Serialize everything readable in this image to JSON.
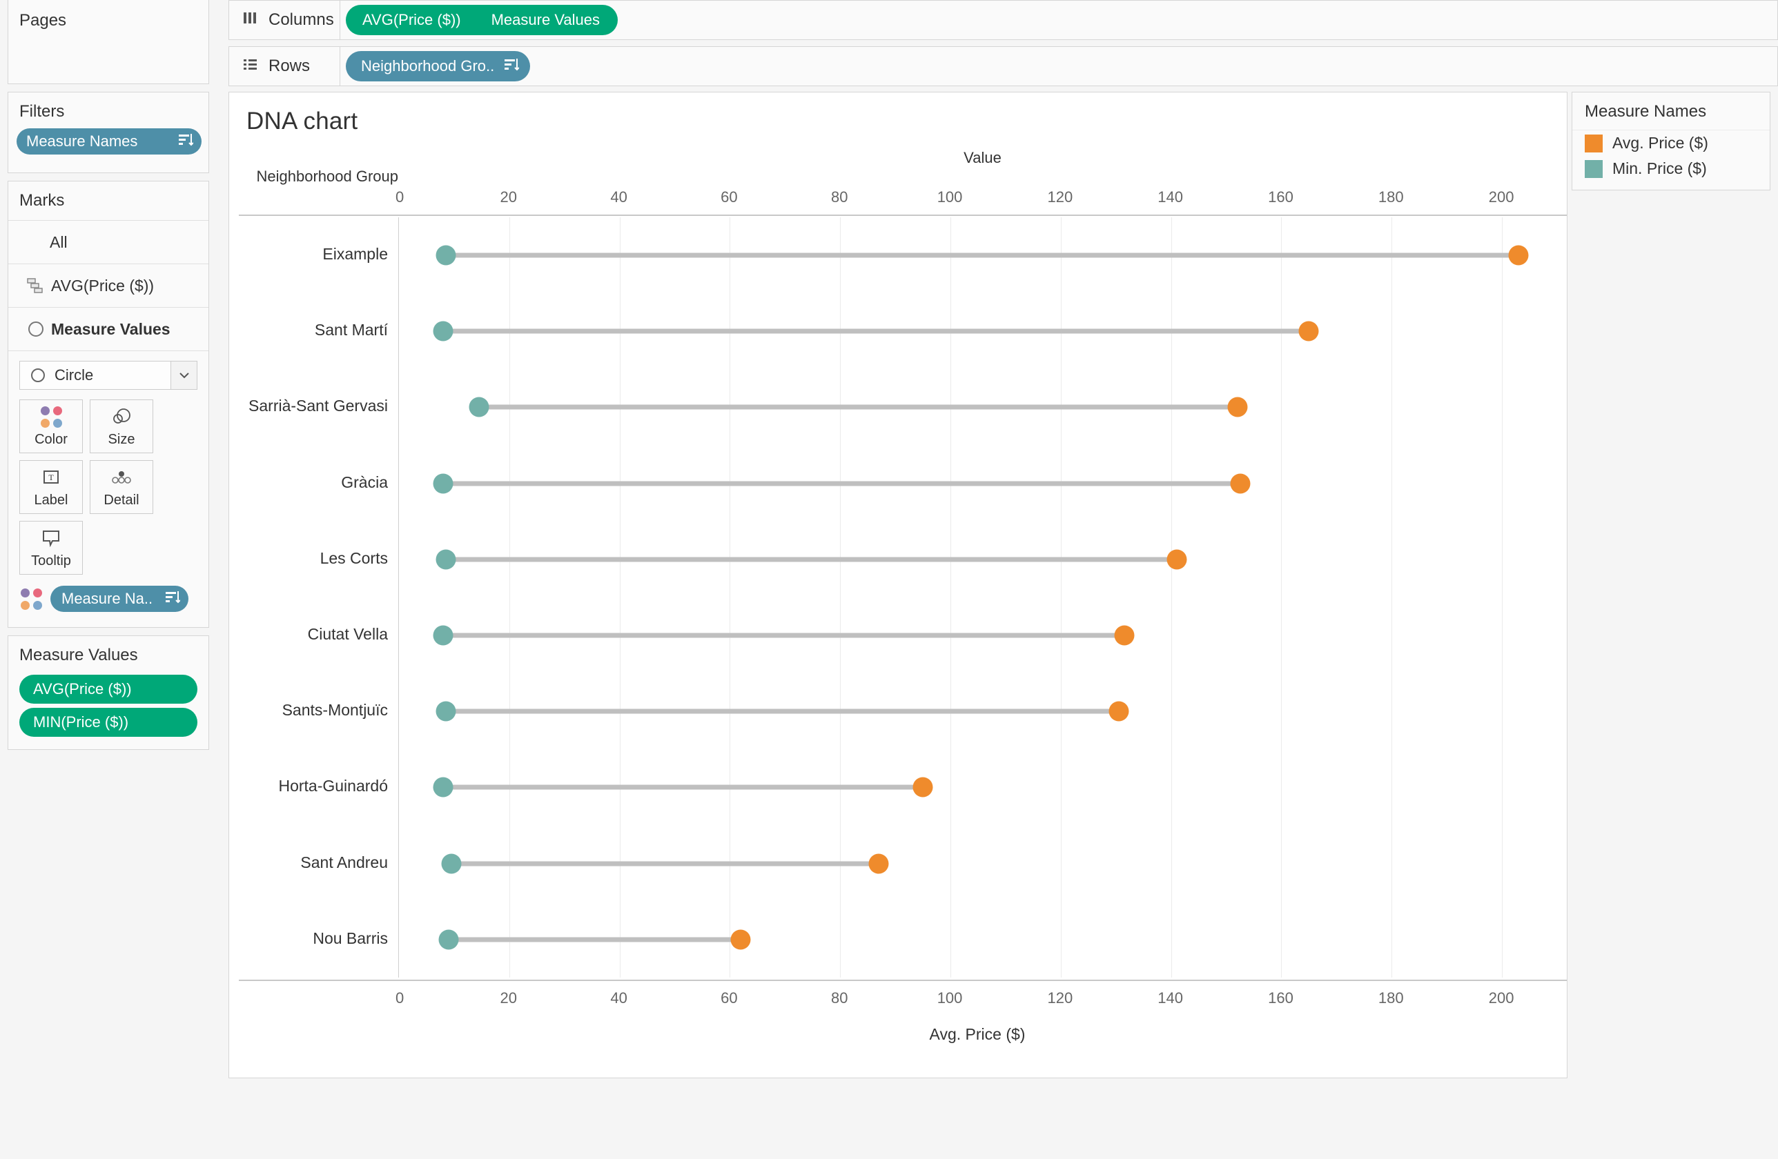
{
  "shelves": {
    "pages": {
      "title": "Pages"
    },
    "filters": {
      "title": "Filters",
      "pill": "Measure Names"
    },
    "columns": {
      "label": "Columns",
      "pills": [
        "AVG(Price ($))",
        "Measure Values"
      ]
    },
    "rows": {
      "label": "Rows",
      "pills": [
        "Neighborhood Gro.."
      ]
    }
  },
  "marks": {
    "title": "Marks",
    "all_label": "All",
    "card_rows": [
      {
        "label": "AVG(Price ($))",
        "icon": "gantt-icon",
        "active": false
      },
      {
        "label": "Measure Values",
        "icon": "circle-icon",
        "active": true
      }
    ],
    "mark_type": "Circle",
    "buttons": [
      {
        "label": "Color",
        "icon": "color-dots-icon"
      },
      {
        "label": "Size",
        "icon": "size-circles-icon"
      },
      {
        "label": "Label",
        "icon": "label-text-icon"
      },
      {
        "label": "Detail",
        "icon": "detail-dots-icon"
      },
      {
        "label": "Tooltip",
        "icon": "tooltip-bubble-icon"
      }
    ],
    "color_pill": "Measure Na..",
    "color_swatches": [
      "#8e7cb0",
      "#e8697d",
      "#f0a868",
      "#7ea7cc"
    ]
  },
  "measure_values": {
    "title": "Measure Values",
    "pills": [
      "AVG(Price ($))",
      "MIN(Price ($))"
    ]
  },
  "legend": {
    "title": "Measure Names",
    "items": [
      {
        "label": "Avg. Price ($)",
        "color": "#ef8b2c"
      },
      {
        "label": "Min. Price ($)",
        "color": "#72b0a8"
      }
    ]
  },
  "colors": {
    "pill_green": "#00a878",
    "pill_blue": "#4e8fa8",
    "avg": "#ef8b2c",
    "min": "#72b0a8",
    "connector": "#bfbfbf"
  },
  "chart_data": {
    "type": "bar",
    "subtype": "dumbbell-dna-chart",
    "title": "DNA chart",
    "top_axis_title": "Value",
    "row_header_title": "Neighborhood Group",
    "xlabel": "Avg. Price ($)",
    "ylabel": "Neighborhood Group",
    "xlim": [
      0,
      210
    ],
    "xticks": [
      0,
      20,
      40,
      60,
      80,
      100,
      120,
      140,
      160,
      180,
      200
    ],
    "xticklabels": [
      "0",
      "20",
      "40",
      "60",
      "80",
      "100",
      "120",
      "140",
      "160",
      "180",
      "200"
    ],
    "grid": true,
    "legend_position": "right",
    "categories": [
      "Eixample",
      "Sant Martí",
      "Sarrià-Sant Gervasi",
      "Gràcia",
      "Les Corts",
      "Ciutat Vella",
      "Sants-Montjuïc",
      "Horta-Guinardó",
      "Sant Andreu",
      "Nou Barris"
    ],
    "series": [
      {
        "name": "Avg. Price ($)",
        "color": "#ef8b2c",
        "values": [
          203.0,
          165.0,
          152.0,
          152.5,
          141.0,
          131.5,
          130.5,
          95.0,
          87.0,
          62.0
        ]
      },
      {
        "name": "Min. Price ($)",
        "color": "#72b0a8",
        "values": [
          8.5,
          8.0,
          14.5,
          8.0,
          8.5,
          8.0,
          8.5,
          8.0,
          9.5,
          9.0
        ]
      }
    ]
  }
}
